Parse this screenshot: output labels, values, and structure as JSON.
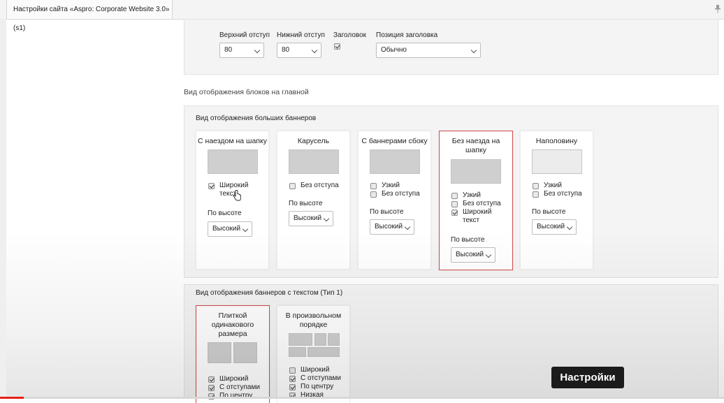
{
  "window": {
    "tab_title": "Настройки сайта «Aspro: Corporate Website 3.0» (s1)",
    "pin_icon": "pin-icon"
  },
  "header_settings": {
    "top_padding": {
      "label": "Верхний отступ",
      "value": "80"
    },
    "bottom_padding": {
      "label": "Нижний отступ",
      "value": "80"
    },
    "heading": {
      "label": "Заголовок",
      "checked": true
    },
    "heading_position": {
      "label": "Позиция заголовка",
      "value": "Обычно"
    }
  },
  "home_blocks_title": "Вид отображения блоков на главной",
  "big_banners": {
    "title": "Вид отображения больших баннеров",
    "cards": [
      {
        "title": "С наездом на шапку",
        "selected": false,
        "options": [
          {
            "label": "Широкий текст",
            "checked": true
          }
        ],
        "height_label": "По высоте",
        "height_value": "Высокий"
      },
      {
        "title": "Карусель",
        "selected": false,
        "options": [
          {
            "label": "Без отступа",
            "checked": false
          }
        ],
        "height_label": "По высоте",
        "height_value": "Высокий"
      },
      {
        "title": "С баннерами сбоку",
        "selected": false,
        "options": [
          {
            "label": "Узкий",
            "checked": false
          },
          {
            "label": "Без отступа",
            "checked": false
          }
        ],
        "height_label": "По высоте",
        "height_value": "Высокий"
      },
      {
        "title": "Без наезда на шапку",
        "selected": true,
        "options": [
          {
            "label": "Узкий",
            "checked": false
          },
          {
            "label": "Без отступа",
            "checked": false
          },
          {
            "label": "Широкий текст",
            "checked": true
          }
        ],
        "height_label": "По высоте",
        "height_value": "Высокий"
      },
      {
        "title": "Наполовину",
        "selected": false,
        "options": [
          {
            "label": "Узкий",
            "checked": false
          },
          {
            "label": "Без отступа",
            "checked": false
          }
        ],
        "height_label": "По высоте",
        "height_value": "Высокий"
      }
    ]
  },
  "text_banners": {
    "title": "Вид отображения баннеров с текстом (Тип 1)",
    "cards": [
      {
        "title": "Плиткой одинакового размера",
        "selected": true,
        "options": [
          {
            "label": "Широкий",
            "checked": true
          },
          {
            "label": "С отступами",
            "checked": true
          },
          {
            "label": "По центру",
            "checked": true
          }
        ]
      },
      {
        "title": "В произвольном порядке",
        "selected": false,
        "options": [
          {
            "label": "Широкий",
            "checked": false
          },
          {
            "label": "С отступами",
            "checked": true
          },
          {
            "label": "По центру",
            "checked": true
          },
          {
            "label": "Низкая",
            "checked": true
          }
        ]
      }
    ]
  },
  "tooltip": "Настройки",
  "video_progress": 0.033,
  "colors": {
    "selected_border": "#d34b4b",
    "progress": "#e62117",
    "tooltip_bg": "#1b1b1b"
  }
}
